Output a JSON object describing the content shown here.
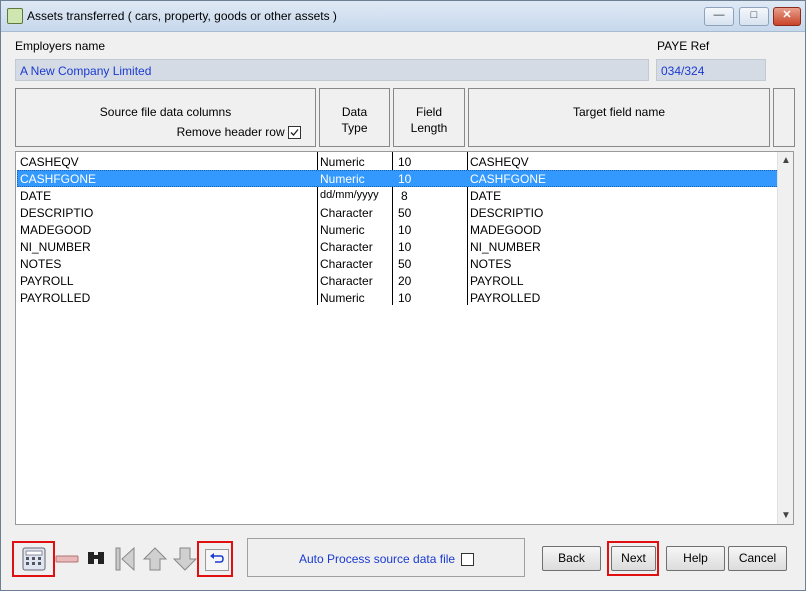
{
  "window": {
    "title": "Assets transferred ( cars, property, goods or other assets )"
  },
  "employer": {
    "label": "Employers name",
    "value": "A New Company Limited"
  },
  "paye": {
    "label": "PAYE Ref",
    "value": "034/324"
  },
  "columns": {
    "source": "Source file data columns",
    "remove_header": "Remove header row",
    "data_type_1": "Data",
    "data_type_2": "Type",
    "field_length_1": "Field",
    "field_length_2": "Length",
    "target": "Target field name"
  },
  "rows": [
    {
      "source": "CASHEQV",
      "type": "Numeric",
      "length": "10",
      "target": "CASHEQV"
    },
    {
      "source": "CASHFGONE",
      "type": "Numeric",
      "length": "10",
      "target": "CASHFGONE"
    },
    {
      "source": "DATE",
      "type": "dd/mm/yyyy",
      "length": "8",
      "target": "DATE"
    },
    {
      "source": "DESCRIPTIO",
      "type": "Character",
      "length": "50",
      "target": "DESCRIPTIO"
    },
    {
      "source": "MADEGOOD",
      "type": "Numeric",
      "length": "10",
      "target": "MADEGOOD"
    },
    {
      "source": "NI_NUMBER",
      "type": "Character",
      "length": "10",
      "target": "NI_NUMBER"
    },
    {
      "source": "NOTES",
      "type": "Character",
      "length": "50",
      "target": "NOTES"
    },
    {
      "source": "PAYROLL",
      "type": "Character",
      "length": "20",
      "target": "PAYROLL"
    },
    {
      "source": "PAYROLLED",
      "type": "Numeric",
      "length": "10",
      "target": "PAYROLLED"
    }
  ],
  "selected_row": 1,
  "auto_process": {
    "label": "Auto Process source data file",
    "checked": false
  },
  "buttons": {
    "back": "Back",
    "next": "Next",
    "help": "Help",
    "cancel": "Cancel"
  },
  "icons": [
    "calculator-icon",
    "minus-icon",
    "binoculars-icon",
    "first-record-icon",
    "up-arrow-icon",
    "down-arrow-icon",
    "undo-icon"
  ],
  "colors": {
    "selection": "#3399ff",
    "field_text": "#1a3ad0",
    "highlight_box": "#e01010"
  }
}
